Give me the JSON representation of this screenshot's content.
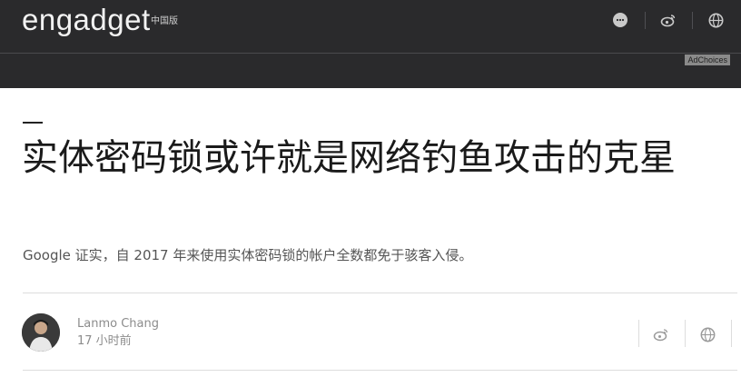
{
  "header": {
    "logo": "engadget",
    "logo_sub": "中国版",
    "icons": [
      "chat-icon",
      "weibo-icon",
      "globe-icon"
    ],
    "ad_label": "AdChoices",
    "background": "#2a2a2c"
  },
  "article": {
    "accent_mark": "—",
    "title": "实体密码锁或许就是网络钓鱼攻击的克星",
    "subtitle": "Google 证实，自 2017 年来使用实体密码锁的帐户全数都免于骇客入侵。",
    "author": "Lanmo Chang",
    "time": "17 小时前"
  },
  "share": {
    "icons": [
      "weibo-icon",
      "globe-icon"
    ]
  }
}
